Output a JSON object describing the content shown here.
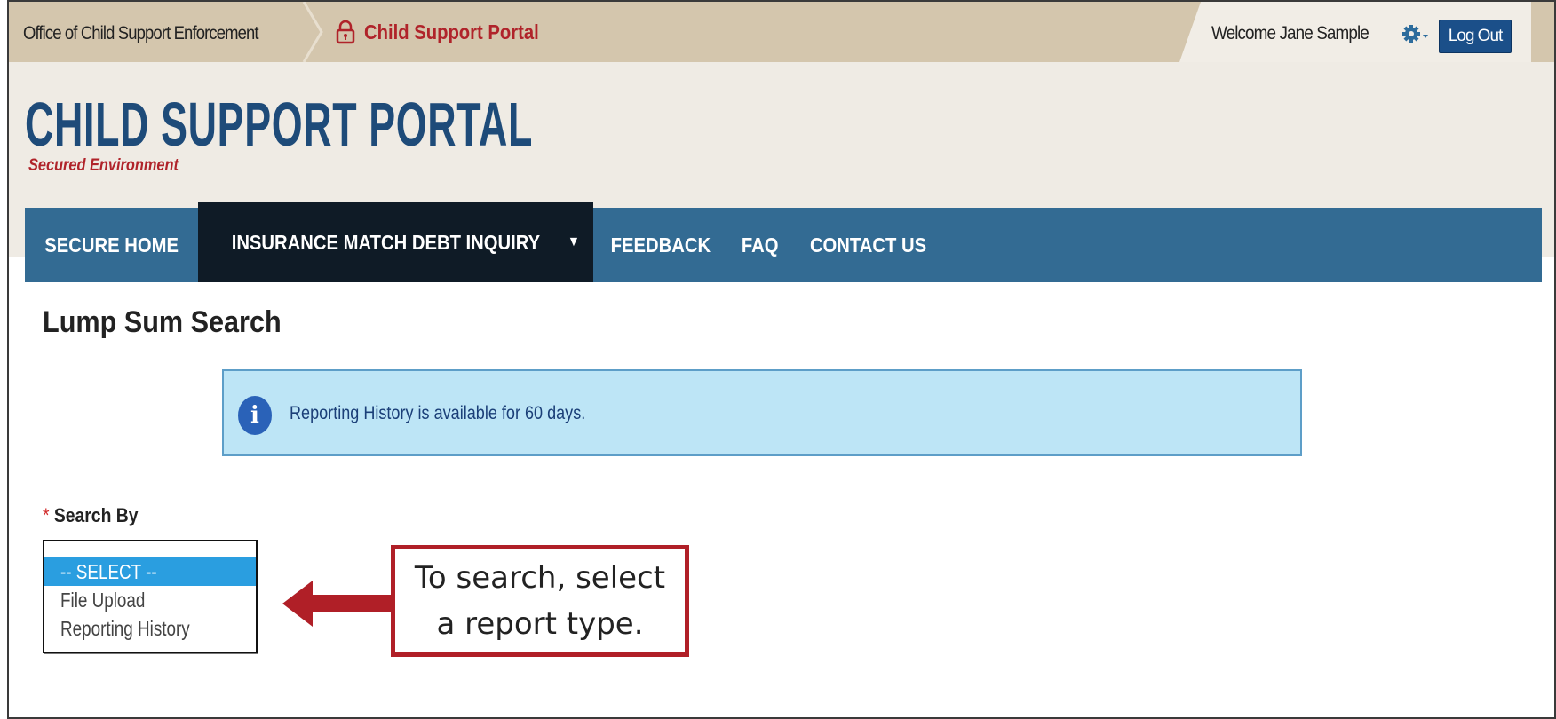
{
  "topbar": {
    "agency": "Office of Child Support Enforcement",
    "portal_link": "Child Support Portal",
    "lock_icon": "lock-icon",
    "welcome": "Welcome Jane Sample",
    "gear_icon": "gear-icon",
    "logout_label": "Log Out"
  },
  "header": {
    "title": "CHILD SUPPORT PORTAL",
    "subtitle": "Secured Environment"
  },
  "nav": {
    "items": [
      "SECURE HOME",
      "INSURANCE MATCH DEBT INQUIRY",
      "FEEDBACK",
      "FAQ",
      "CONTACT US"
    ],
    "active": "INSURANCE MATCH DEBT INQUIRY"
  },
  "main": {
    "title": "Lump Sum Search",
    "info_message": "Reporting History is available for 60 days.",
    "search_by": {
      "label": "Search By",
      "required_marker": "*",
      "options": [
        "-- SELECT --",
        "File Upload",
        "Reporting History"
      ],
      "selected": "-- SELECT --"
    }
  },
  "callout": {
    "line1": "To search, select",
    "line2": "a report type."
  },
  "colors": {
    "nav": "#336b93",
    "nav_active": "#0f1b26",
    "brand": "#1e4b79",
    "accent_red": "#b0232a",
    "info_bg": "#bde5f6",
    "selected_option": "#2a9ee0"
  }
}
